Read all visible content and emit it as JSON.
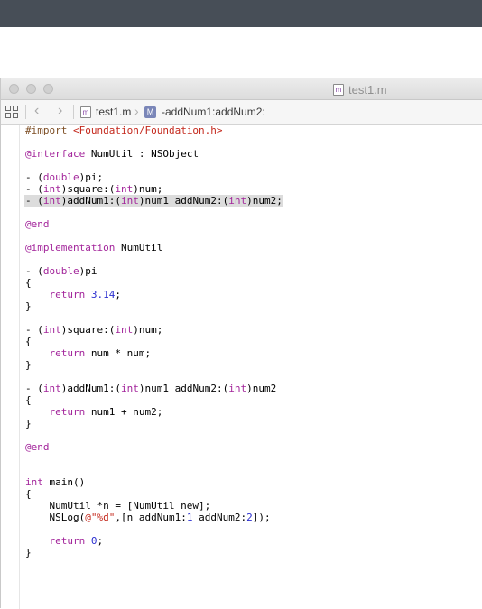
{
  "window": {
    "title": "test1.m",
    "file_icon_letter": "m"
  },
  "jumpbar": {
    "file_name": "test1.m",
    "file_icon_letter": "m",
    "method_icon_letter": "M",
    "method_name": "-addNum1:addNum2:"
  },
  "colors": {
    "keyword": "#a3259b",
    "directive": "#7d4e24",
    "string": "#c4281c",
    "number": "#2b2fd0",
    "highlight": "#dcdcdc",
    "top_band": "#474e57"
  },
  "code": {
    "lines": [
      [
        {
          "t": "#import ",
          "c": "dir"
        },
        {
          "t": "<Foundation/Foundation.h>",
          "c": "str"
        }
      ],
      [],
      [
        {
          "t": "@interface",
          "c": "kw"
        },
        {
          "t": " NumUtil : NSObject"
        }
      ],
      [],
      [
        {
          "t": "- ("
        },
        {
          "t": "double",
          "c": "kw"
        },
        {
          "t": ")pi;"
        }
      ],
      [
        {
          "t": "- ("
        },
        {
          "t": "int",
          "c": "kw"
        },
        {
          "t": ")square:("
        },
        {
          "t": "int",
          "c": "kw"
        },
        {
          "t": ")num;"
        }
      ],
      [
        {
          "t": "- ("
        },
        {
          "t": "int",
          "c": "kw"
        },
        {
          "t": ")addNum1:("
        },
        {
          "t": "int",
          "c": "kw"
        },
        {
          "t": ")num1 addNum2:("
        },
        {
          "t": "int",
          "c": "kw"
        },
        {
          "t": ")num2;"
        }
      ],
      [],
      [
        {
          "t": "@end",
          "c": "kw"
        }
      ],
      [],
      [
        {
          "t": "@implementation",
          "c": "kw"
        },
        {
          "t": " NumUtil"
        }
      ],
      [],
      [
        {
          "t": "- ("
        },
        {
          "t": "double",
          "c": "kw"
        },
        {
          "t": ")pi"
        }
      ],
      [
        {
          "t": "{"
        }
      ],
      [
        {
          "t": "    "
        },
        {
          "t": "return",
          "c": "kw"
        },
        {
          "t": " "
        },
        {
          "t": "3.14",
          "c": "num"
        },
        {
          "t": ";"
        }
      ],
      [
        {
          "t": "}"
        }
      ],
      [],
      [
        {
          "t": "- ("
        },
        {
          "t": "int",
          "c": "kw"
        },
        {
          "t": ")square:("
        },
        {
          "t": "int",
          "c": "kw"
        },
        {
          "t": ")num;"
        }
      ],
      [
        {
          "t": "{"
        }
      ],
      [
        {
          "t": "    "
        },
        {
          "t": "return",
          "c": "kw"
        },
        {
          "t": " num * num;"
        }
      ],
      [
        {
          "t": "}"
        }
      ],
      [],
      [
        {
          "t": "- ("
        },
        {
          "t": "int",
          "c": "kw"
        },
        {
          "t": ")addNum1:("
        },
        {
          "t": "int",
          "c": "kw"
        },
        {
          "t": ")num1 addNum2:("
        },
        {
          "t": "int",
          "c": "kw"
        },
        {
          "t": ")num2"
        }
      ],
      [
        {
          "t": "{"
        }
      ],
      [
        {
          "t": "    "
        },
        {
          "t": "return",
          "c": "kw"
        },
        {
          "t": " num1 + num2;"
        }
      ],
      [
        {
          "t": "}"
        }
      ],
      [],
      [
        {
          "t": "@end",
          "c": "kw"
        }
      ],
      [],
      [],
      [
        {
          "t": "int",
          "c": "kw"
        },
        {
          "t": " main()"
        }
      ],
      [
        {
          "t": "{"
        }
      ],
      [
        {
          "t": "    NumUtil *n = [NumUtil new];"
        }
      ],
      [
        {
          "t": "    NSLog("
        },
        {
          "t": "@\"%d\"",
          "c": "str"
        },
        {
          "t": ",[n addNum1:"
        },
        {
          "t": "1",
          "c": "num"
        },
        {
          "t": " addNum2:"
        },
        {
          "t": "2",
          "c": "num"
        },
        {
          "t": "]);"
        }
      ],
      [],
      [
        {
          "t": "    "
        },
        {
          "t": "return",
          "c": "kw"
        },
        {
          "t": " "
        },
        {
          "t": "0",
          "c": "num"
        },
        {
          "t": ";"
        }
      ],
      [
        {
          "t": "}"
        }
      ]
    ],
    "highlighted_line": 6
  }
}
